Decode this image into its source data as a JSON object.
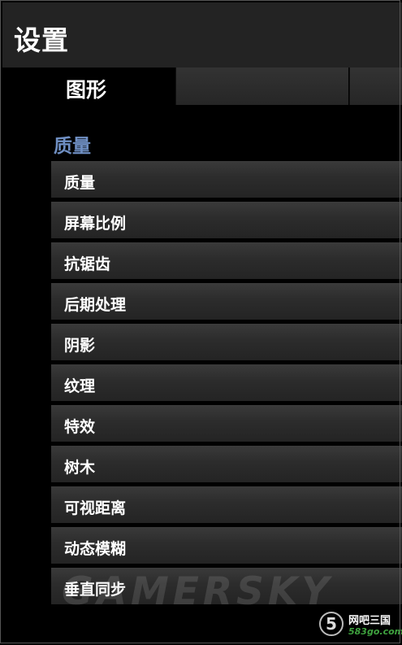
{
  "header": {
    "title": "设置"
  },
  "tabs": [
    {
      "label": "图形"
    },
    {
      "label": ""
    },
    {
      "label": ""
    }
  ],
  "section": {
    "title": "质量"
  },
  "settings": [
    {
      "label": "质量"
    },
    {
      "label": "屏幕比例"
    },
    {
      "label": "抗锯齿"
    },
    {
      "label": "后期处理"
    },
    {
      "label": "阴影"
    },
    {
      "label": "纹理"
    },
    {
      "label": "特效"
    },
    {
      "label": "树木"
    },
    {
      "label": "可视距离"
    },
    {
      "label": "动态模糊"
    },
    {
      "label": "垂直同步"
    }
  ],
  "watermark": "GAMERSKY",
  "logo": {
    "mark": "5",
    "name": "网吧三国",
    "url": "583go.com"
  }
}
